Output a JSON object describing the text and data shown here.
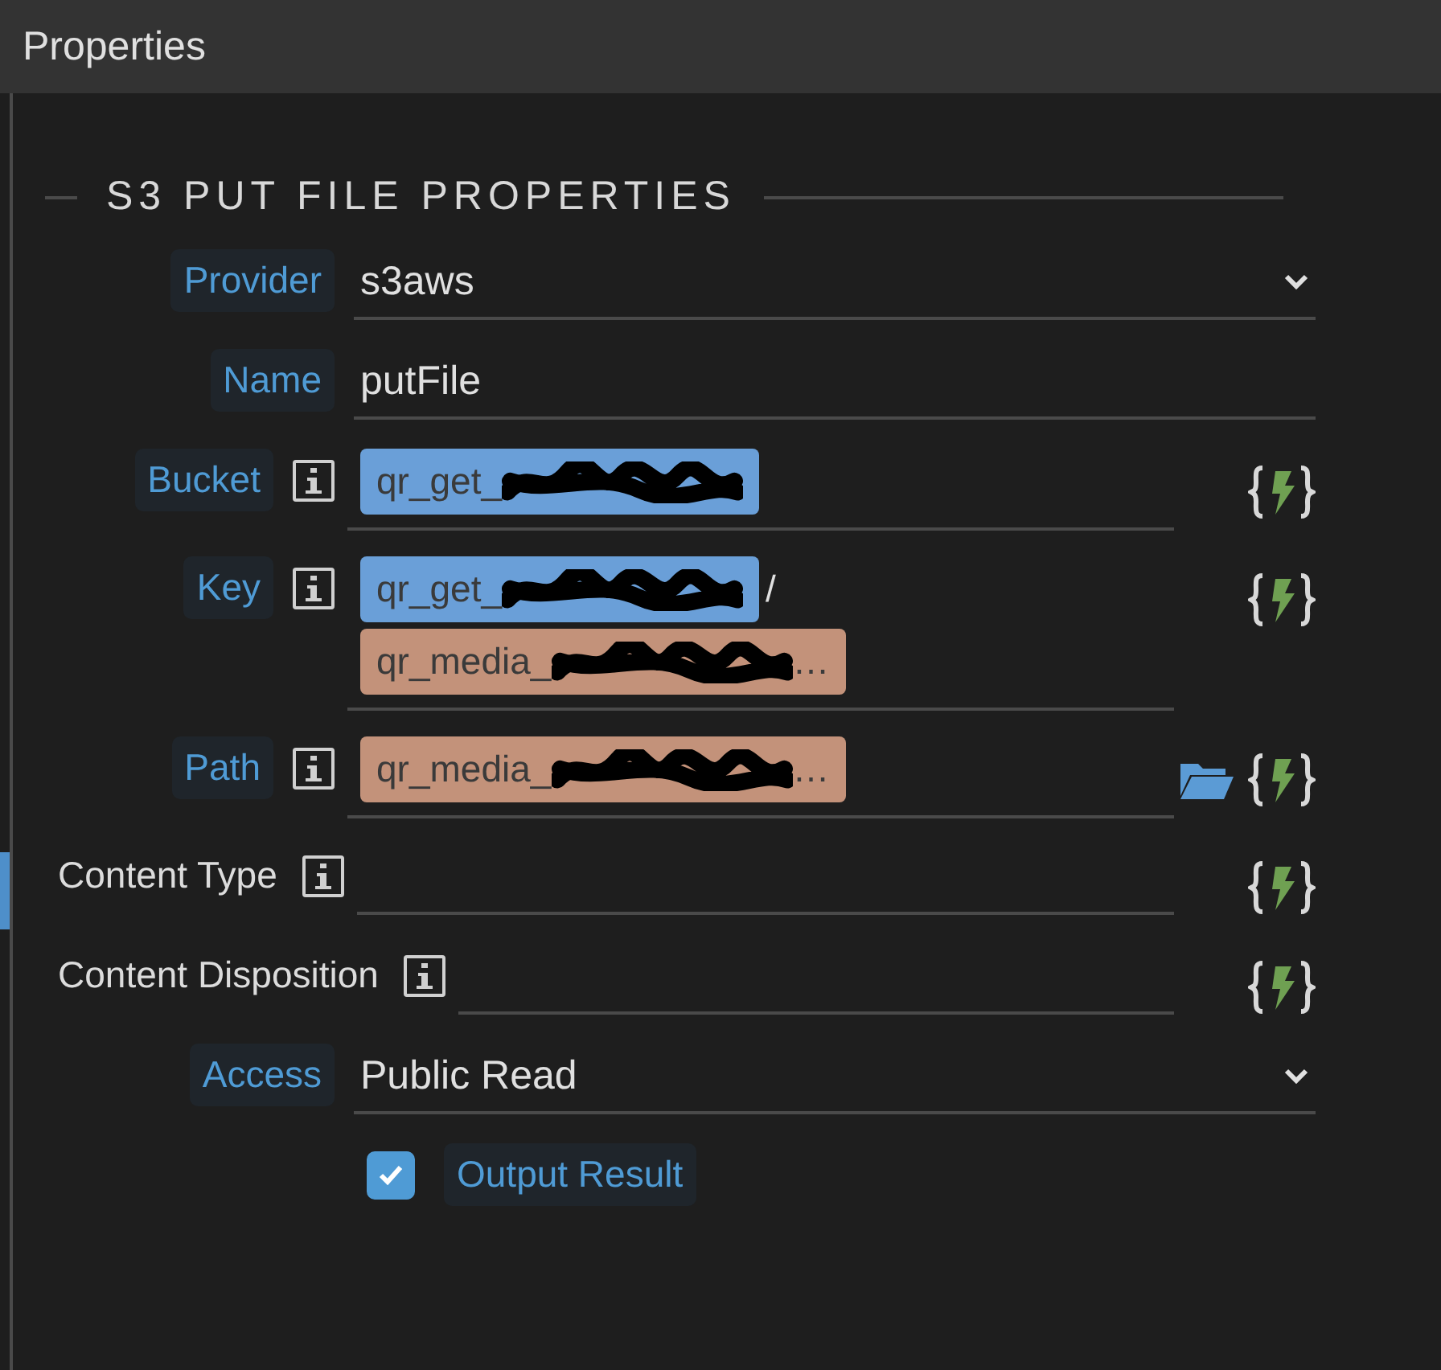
{
  "panel": {
    "title": "Properties"
  },
  "section": {
    "title": "S3 PUT FILE PROPERTIES"
  },
  "fields": [
    {
      "label": {
        "text": "Provider",
        "kind": "tag"
      },
      "kind": "select",
      "value": "s3aws",
      "info": false,
      "dynamic": false,
      "folder": false
    },
    {
      "label": {
        "text": "Name",
        "kind": "tag"
      },
      "kind": "text",
      "value": "putFile",
      "info": false,
      "dynamic": false,
      "folder": false
    },
    {
      "label": {
        "text": "Bucket",
        "kind": "tag"
      },
      "kind": "tokens",
      "info": true,
      "dynamic": true,
      "folder": false,
      "tokens": [
        {
          "text": "qr_get_",
          "color": "#6a9fd8"
        }
      ]
    },
    {
      "label": {
        "text": "Key",
        "kind": "tag"
      },
      "kind": "tokens",
      "info": true,
      "dynamic": true,
      "folder": false,
      "tokens": [
        {
          "text": "qr_get_",
          "color": "#6a9fd8",
          "separator": "/"
        },
        {
          "text": "qr_media_",
          "tail": "…",
          "color": "#c3927a"
        }
      ]
    },
    {
      "label": {
        "text": "Path",
        "kind": "tag"
      },
      "kind": "tokens",
      "info": true,
      "dynamic": true,
      "folder": true,
      "tokens": [
        {
          "text": "qr_media_",
          "tail": "…",
          "color": "#c3927a"
        }
      ]
    },
    {
      "label": {
        "text": "Content Type",
        "kind": "plain"
      },
      "kind": "text",
      "info": true,
      "dynamic": true,
      "folder": false
    },
    {
      "label": {
        "text": "Content Disposition",
        "kind": "plain"
      },
      "kind": "text",
      "info": true,
      "dynamic": true,
      "folder": false
    },
    {
      "label": {
        "text": "Access",
        "kind": "tag"
      },
      "kind": "select",
      "value": "Public Read",
      "info": false,
      "dynamic": false,
      "folder": false
    }
  ],
  "output": {
    "label": "Output Result",
    "checked": true
  }
}
